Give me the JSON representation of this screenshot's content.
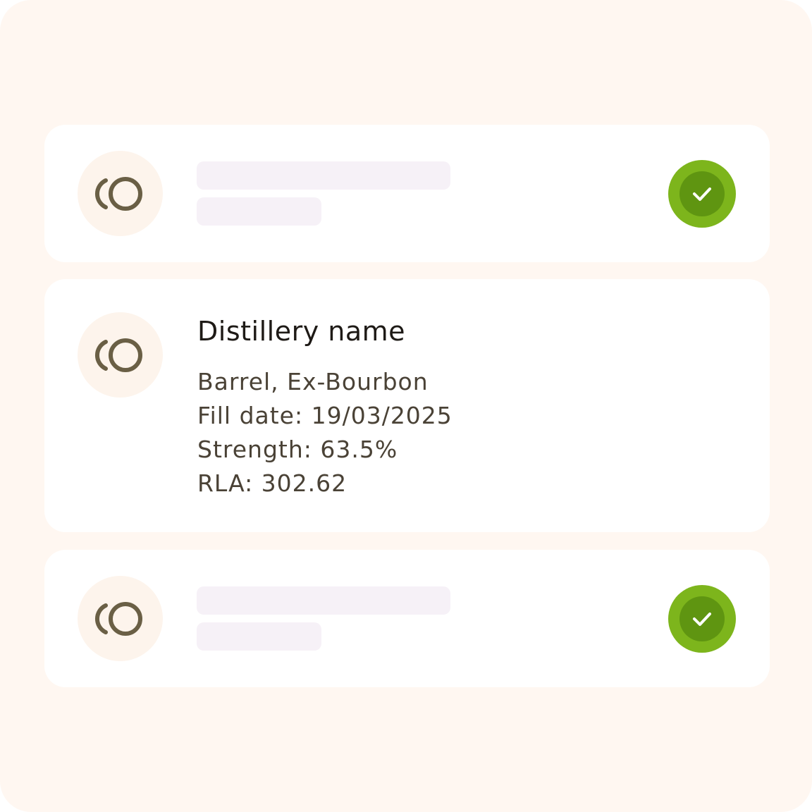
{
  "colors": {
    "page_background": "#fff7f1",
    "card_background": "#ffffff",
    "icon_badge": "#fdf4ec",
    "icon_stroke": "#6a5f45",
    "skeleton": "#f6f1f7",
    "check_outer": "#7db51c",
    "check_inner": "#5f9511",
    "title_text": "#1e1a16",
    "detail_text": "#4a4236"
  },
  "cards": [
    {
      "state": "loading",
      "icon": "distillery-logo-icon",
      "status_icon": "checkmark-icon"
    },
    {
      "state": "expanded",
      "icon": "distillery-logo-icon",
      "title": "Distillery name",
      "details": [
        "Barrel, Ex-Bourbon",
        "Fill date: 19/03/2025",
        "Strength: 63.5%",
        "RLA: 302.62"
      ]
    },
    {
      "state": "loading",
      "icon": "distillery-logo-icon",
      "status_icon": "checkmark-icon"
    }
  ]
}
